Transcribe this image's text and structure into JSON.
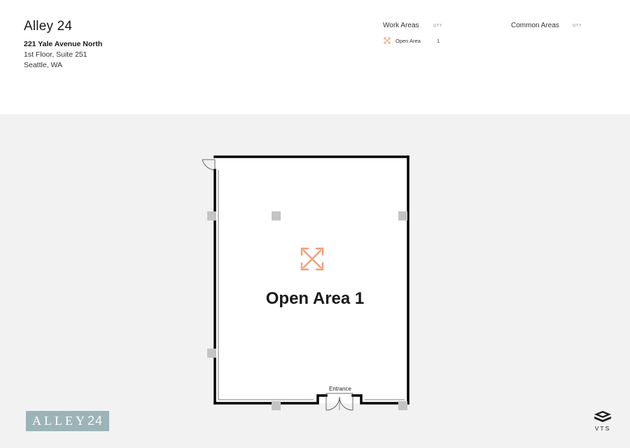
{
  "header": {
    "title": "Alley 24",
    "address_line1": "221 Yale Avenue North",
    "address_line2": "1st Floor, Suite 251",
    "address_line3": "Seattle, WA"
  },
  "legend": {
    "work_areas_title": "Work Areas",
    "work_areas_qty_header": "QTY",
    "common_areas_title": "Common Areas",
    "common_areas_qty_header": "QTY",
    "work_items": [
      {
        "label": "Open Area",
        "qty": "1",
        "icon": "expand-arrows-icon"
      }
    ]
  },
  "plan": {
    "room_label": "Open Area 1",
    "entrance_label": "Entrance",
    "room_icon": "expand-arrows-icon"
  },
  "branding": {
    "logo_text_a": "ALLEY",
    "logo_text_b": "24",
    "vts_text": "VTS"
  },
  "colors": {
    "accent": "#f0a07a",
    "wall": "#000000",
    "column": "#c4c4c4",
    "background": "#f2f2f2",
    "logo_bg": "#9cb4b7"
  }
}
